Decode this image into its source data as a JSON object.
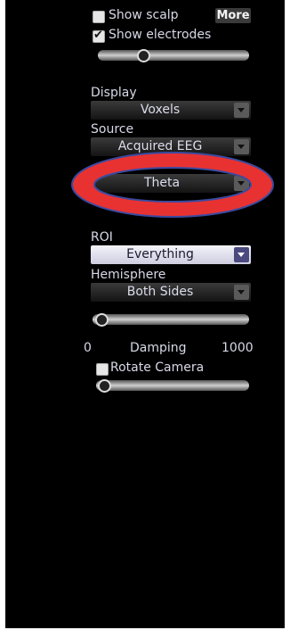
{
  "panel": {
    "show_scalp": {
      "label": "Show scalp",
      "checked": false
    },
    "more_button": "More",
    "show_electrodes": {
      "label": "Show electrodes",
      "checked": true
    },
    "display": {
      "label": "Display",
      "value": "Voxels"
    },
    "source": {
      "label": "Source",
      "value": "Acquired EEG"
    },
    "band": {
      "value": "Theta"
    },
    "roi": {
      "label": "ROI",
      "value": "Everything"
    },
    "hemisphere": {
      "label": "Hemisphere",
      "value": "Both Sides"
    },
    "damping": {
      "label": "Damping",
      "min": "0",
      "max": "1000",
      "fraction": 0.0
    },
    "rotate_camera": {
      "label": "Rotate Camera",
      "checked": false,
      "fraction": 0.0
    },
    "top_slider": {
      "fraction": 0.3
    }
  },
  "annotation": {
    "color": "#e83232",
    "stroke": "#3a4aa0"
  }
}
